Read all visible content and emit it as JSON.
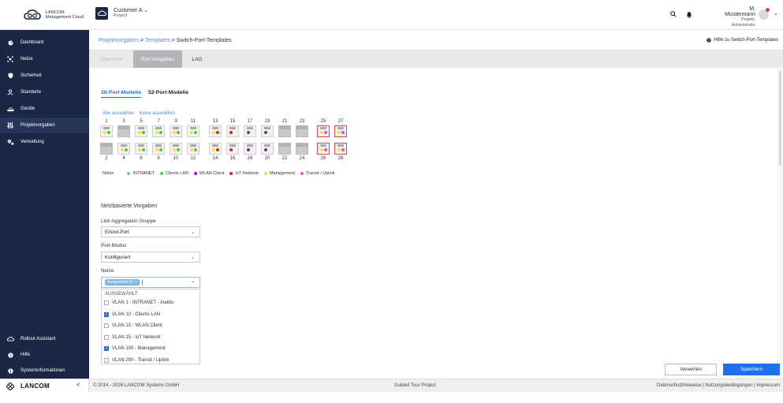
{
  "header": {
    "logo_line1": "LANCOM",
    "logo_line2": "Management Cloud",
    "project_name": "Customer A",
    "project_label": "Project",
    "user_name": "M. Mustermann",
    "user_role": "Projekt-Administrator"
  },
  "sidebar": {
    "items": [
      {
        "label": "Dashboard",
        "icon": "dashboard-icon"
      },
      {
        "label": "Netze",
        "icon": "network-icon"
      },
      {
        "label": "Sicherheit",
        "icon": "shield-icon"
      },
      {
        "label": "Standorte",
        "icon": "location-icon"
      },
      {
        "label": "Geräte",
        "icon": "devices-icon"
      },
      {
        "label": "Projektvorgaben",
        "icon": "sliders-icon"
      },
      {
        "label": "Verwaltung",
        "icon": "gears-icon"
      }
    ],
    "bottom_items": [
      {
        "label": "Rollout Assistant",
        "icon": "cloud-icon"
      },
      {
        "label": "Hilfe",
        "icon": "help-icon"
      },
      {
        "label": "Systeminformationen",
        "icon": "info-icon"
      }
    ],
    "active_index": 5
  },
  "breadcrumb": {
    "item1": "Projektvorgaben",
    "sep1": ">",
    "item2": "Templates",
    "sep2": ">",
    "current": "Switch-Port-Templates",
    "help_link": "Hilfe zu Switch-Port-Templates"
  },
  "tabs": [
    {
      "label": "Übersicht",
      "active": false
    },
    {
      "label": "Port-Vorgaben",
      "active": true
    },
    {
      "label": "LAG",
      "active": false
    }
  ],
  "subtabs": [
    {
      "label": "28-Port-Modelle",
      "active": true
    },
    {
      "label": "52-Port-Modelle",
      "active": false
    }
  ],
  "select_all": "Alle auswählen",
  "select_none": "Keine auswählen",
  "top_port_numbers": [
    "1",
    "3",
    "5",
    "7",
    "9",
    "11",
    "13",
    "15",
    "17",
    "19",
    "21",
    "23",
    "25",
    "27"
  ],
  "bottom_port_numbers": [
    "2",
    "4",
    "6",
    "8",
    "10",
    "12",
    "14",
    "16",
    "18",
    "20",
    "22",
    "24",
    "26",
    "28"
  ],
  "colors": {
    "INTRANET": "#6fb6e8",
    "Clients LAN": "#4cc94c",
    "WLAN Client": "#8a1fb8",
    "IoT Network": "#d8262b",
    "Management": "#f3e23a",
    "Transit / Uplink": "#e64fc8",
    "accent": "#2a6fc7",
    "sidebar": "#1b2744"
  },
  "ports_top": [
    {
      "dots": [
        "Management",
        "Clients LAN"
      ],
      "inactive": false,
      "selected": false
    },
    {
      "dots": [],
      "inactive": true,
      "selected": false
    },
    {
      "dots": [
        "Management",
        "Clients LAN"
      ],
      "inactive": false,
      "selected": false
    },
    {
      "dots": [
        "Management",
        "Clients LAN"
      ],
      "inactive": false,
      "selected": false
    },
    {
      "dots": [
        "Management",
        "Clients LAN"
      ],
      "inactive": false,
      "selected": false
    },
    {
      "dots": [
        "Management",
        "Clients LAN"
      ],
      "inactive": false,
      "selected": false
    },
    {
      "dots": [
        "Management",
        "IoT Network"
      ],
      "inactive": false,
      "selected": false
    },
    {
      "dots": [
        "IoT Network"
      ],
      "inactive": false,
      "selected": false
    },
    {
      "dots": [
        "WLAN Client"
      ],
      "inactive": false,
      "selected": false
    },
    {
      "dots": [
        "WLAN Client"
      ],
      "inactive": false,
      "selected": false
    },
    {
      "dots": [],
      "inactive": true,
      "selected": false
    },
    {
      "dots": [],
      "inactive": true,
      "selected": false
    },
    {
      "dots": [
        "Management",
        "Transit / Uplink"
      ],
      "inactive": false,
      "selected": true
    },
    {
      "dots": [
        "Management",
        "Transit / Uplink"
      ],
      "inactive": false,
      "selected": true
    }
  ],
  "ports_bottom": [
    {
      "dots": [],
      "inactive": true,
      "selected": false
    },
    {
      "dots": [
        "Management",
        "Clients LAN"
      ],
      "inactive": false,
      "selected": false
    },
    {
      "dots": [
        "Management",
        "Clients LAN"
      ],
      "inactive": false,
      "selected": false
    },
    {
      "dots": [
        "Management",
        "Clients LAN"
      ],
      "inactive": false,
      "selected": false
    },
    {
      "dots": [
        "Management",
        "Clients LAN"
      ],
      "inactive": false,
      "selected": false
    },
    {
      "dots": [
        "Management",
        "Clients LAN"
      ],
      "inactive": false,
      "selected": false
    },
    {
      "dots": [
        "Management",
        "IoT Network"
      ],
      "inactive": false,
      "selected": false
    },
    {
      "dots": [
        "IoT Network"
      ],
      "inactive": false,
      "selected": false
    },
    {
      "dots": [
        "WLAN Client"
      ],
      "inactive": false,
      "selected": false
    },
    {
      "dots": [
        "WLAN Client"
      ],
      "inactive": false,
      "selected": false
    },
    {
      "dots": [],
      "inactive": true,
      "selected": false
    },
    {
      "dots": [],
      "inactive": true,
      "selected": false
    },
    {
      "dots": [
        "Management",
        "Transit / Uplink"
      ],
      "inactive": false,
      "selected": true
    },
    {
      "dots": [
        "Management",
        "Transit / Uplink"
      ],
      "inactive": false,
      "selected": true
    }
  ],
  "legend": {
    "title": "Netze",
    "items": [
      "INTRANET",
      "Clients LAN",
      "WLAN Client",
      "IoT Network",
      "Management",
      "Transit / Uplink"
    ]
  },
  "form": {
    "section_title": "Netzbasierte Vorgaben",
    "lag_label": "Link Aggregation Gruppe",
    "lag_value": "Einzel-Port",
    "mode_label": "Port-Modus",
    "mode_value": "Konfiguriert",
    "nets_label": "Netze",
    "nets_chip": "Ausgewählt (2) ×"
  },
  "dropdown": {
    "header": "AUSGEWÄHLT",
    "options": [
      {
        "label": "VLAN 1 - INTRANET - Inaktiv",
        "checked": false
      },
      {
        "label": "VLAN 10 - Clients LAN",
        "checked": true
      },
      {
        "label": "VLAN 13 - WLAN Client",
        "checked": false
      },
      {
        "label": "VLAN 15 - IoT Network",
        "checked": false
      },
      {
        "label": "VLAN 100 - Management",
        "checked": true
      },
      {
        "label": "VLAN 200 - Transit / Uplink",
        "checked": false
      }
    ]
  },
  "buttons": {
    "cancel": "Verwerfen",
    "save": "Speichern"
  },
  "footer": {
    "brand": "LANCOM",
    "collapse": "<",
    "copyright": "© 2014 - 2026 LANCOM Systems GmbH",
    "guided": "Guided Tour Project",
    "links": "Datenschutzhinweise | Nutzungsbedingungen | Impressum"
  }
}
